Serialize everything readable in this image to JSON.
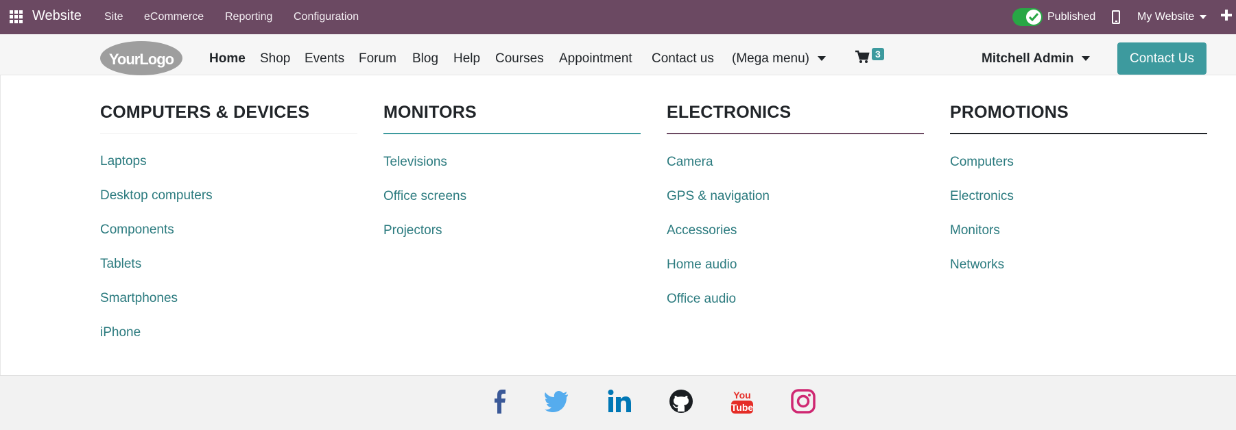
{
  "topbar": {
    "app_title": "Website",
    "menus": [
      "Site",
      "eCommerce",
      "Reporting",
      "Configuration"
    ],
    "published_label": "Published",
    "website_selector": "My Website",
    "bg_color": "#6b4962"
  },
  "navbar": {
    "logo_text": "YourLogo",
    "links": [
      "Home",
      "Shop",
      "Events",
      "Forum",
      "Blog",
      "Help",
      "Courses",
      "Appointment",
      "Contact us"
    ],
    "mega_menu_label": "(Mega menu)",
    "cart_count": "3",
    "user_name": "Mitchell Admin",
    "contact_button": "Contact Us",
    "accent_color": "#3d9a9e"
  },
  "mega_menu": {
    "columns": [
      {
        "heading": "COMPUTERS & DEVICES",
        "items": [
          "Laptops",
          "Desktop computers",
          "Components",
          "Tablets",
          "Smartphones",
          "iPhone"
        ]
      },
      {
        "heading": "MONITORS",
        "items": [
          "Televisions",
          "Office screens",
          "Projectors"
        ]
      },
      {
        "heading": "ELECTRONICS",
        "items": [
          "Camera",
          "GPS & navigation",
          "Accessories",
          "Home audio",
          "Office audio"
        ]
      },
      {
        "heading": "PROMOTIONS",
        "items": [
          "Computers",
          "Electronics",
          "Monitors",
          "Networks"
        ]
      }
    ]
  },
  "footer": {
    "social_icons": [
      "facebook-icon",
      "twitter-icon",
      "linkedin-icon",
      "github-icon",
      "youtube-icon",
      "instagram-icon"
    ]
  }
}
